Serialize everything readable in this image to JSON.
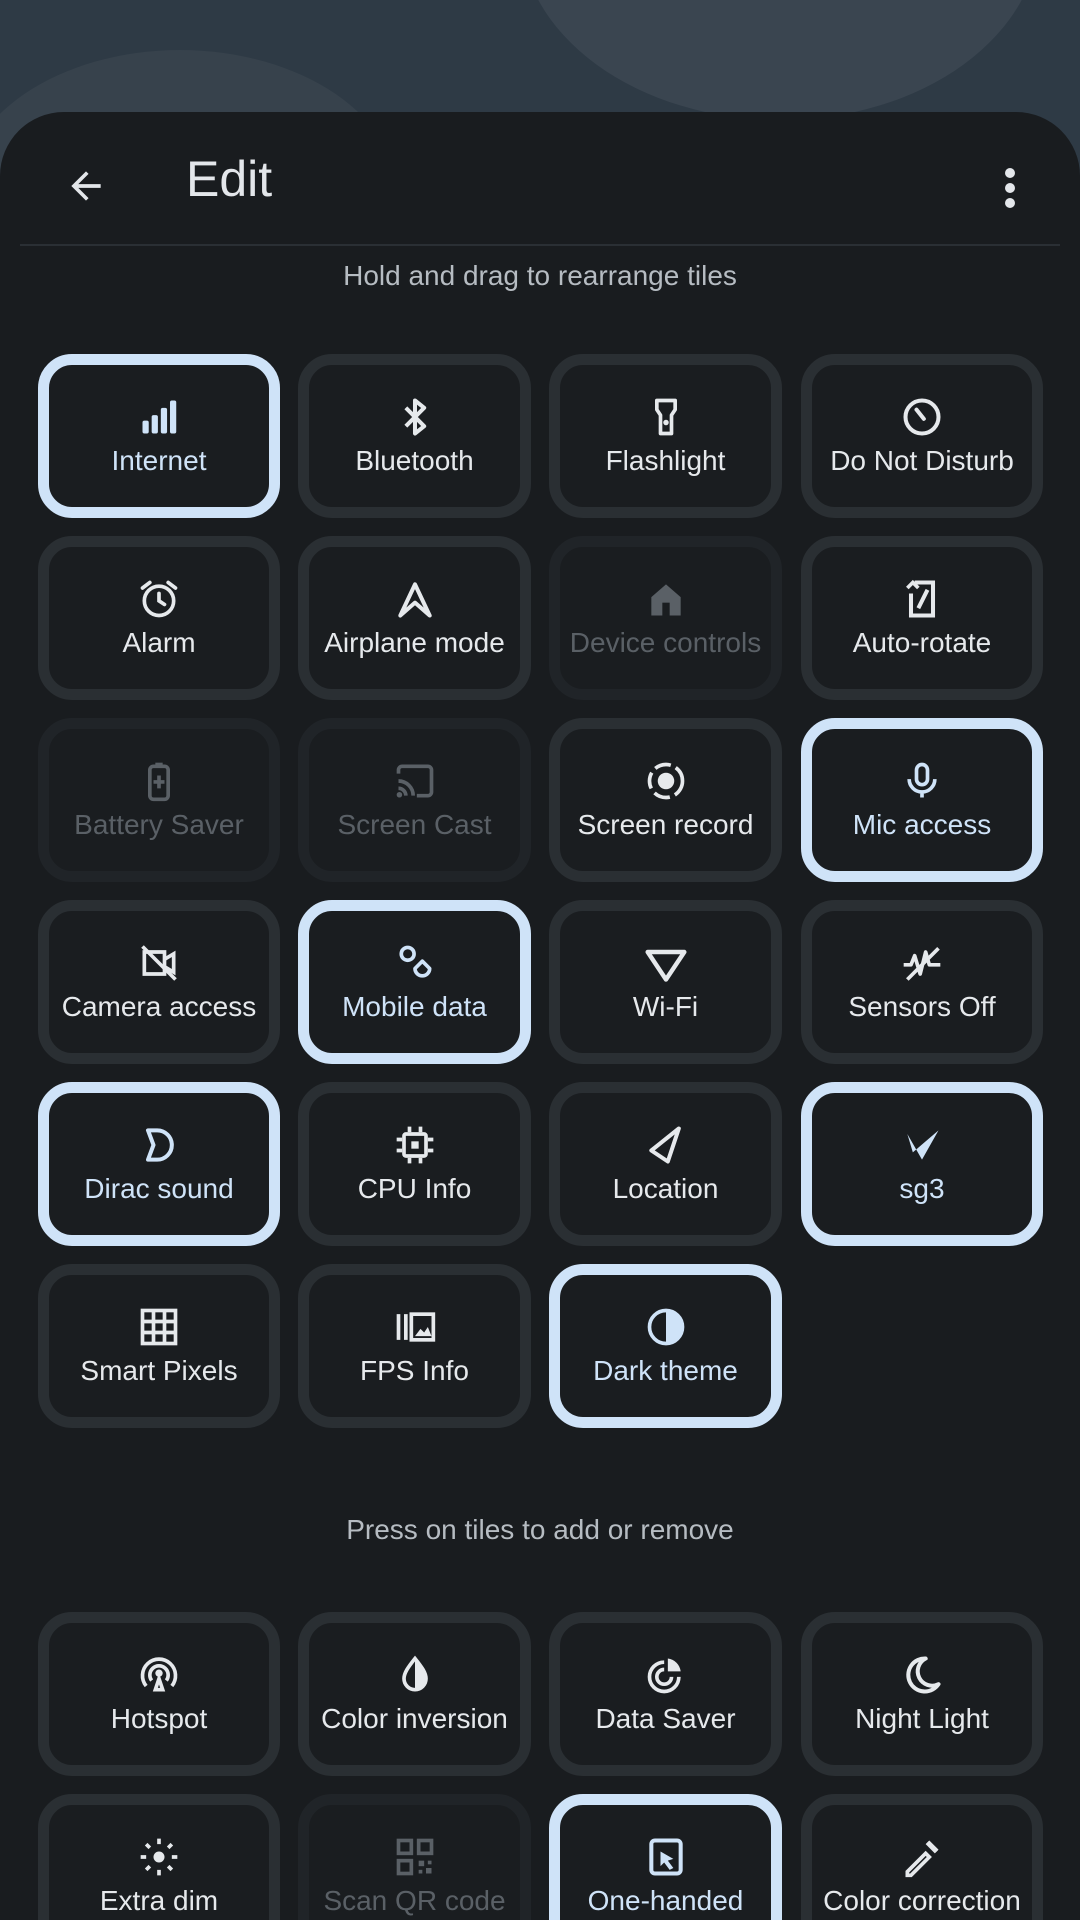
{
  "header": {
    "title": "Edit",
    "back_icon": "arrow-left-icon",
    "more_icon": "more-vert-icon"
  },
  "hints": {
    "rearrange": "Hold and drag to rearrange tiles",
    "add_remove": "Press on tiles to add or remove"
  },
  "colors": {
    "panel_bg": "#191c1f",
    "active_border": "#cfe3f8",
    "tile_border": "#2a2f33",
    "text": "#e6e9ec",
    "disabled_text": "#5a6066"
  },
  "active_tiles": [
    {
      "label": "Internet",
      "icon": "signal-icon",
      "state": "active"
    },
    {
      "label": "Bluetooth",
      "icon": "bluetooth-icon",
      "state": "normal"
    },
    {
      "label": "Flashlight",
      "icon": "flashlight-icon",
      "state": "normal"
    },
    {
      "label": "Do Not Disturb",
      "icon": "do-not-disturb-icon",
      "state": "normal"
    },
    {
      "label": "Alarm",
      "icon": "alarm-icon",
      "state": "normal"
    },
    {
      "label": "Airplane mode",
      "icon": "airplane-icon",
      "state": "normal"
    },
    {
      "label": "Device controls",
      "icon": "home-icon",
      "state": "disabled"
    },
    {
      "label": "Auto-rotate",
      "icon": "auto-rotate-icon",
      "state": "normal"
    },
    {
      "label": "Battery Saver",
      "icon": "battery-icon",
      "state": "disabled"
    },
    {
      "label": "Screen Cast",
      "icon": "cast-icon",
      "state": "disabled"
    },
    {
      "label": "Screen record",
      "icon": "record-icon",
      "state": "normal"
    },
    {
      "label": "Mic access",
      "icon": "mic-icon",
      "state": "active"
    },
    {
      "label": "Camera access",
      "icon": "camera-off-icon",
      "state": "normal"
    },
    {
      "label": "Mobile data",
      "icon": "mobile-data-icon",
      "state": "active"
    },
    {
      "label": "Wi-Fi",
      "icon": "wifi-icon",
      "state": "normal"
    },
    {
      "label": "Sensors Off",
      "icon": "sensors-off-icon",
      "state": "normal"
    },
    {
      "label": "Dirac sound",
      "icon": "dirac-icon",
      "state": "active"
    },
    {
      "label": "CPU Info",
      "icon": "cpu-icon",
      "state": "normal"
    },
    {
      "label": "Location",
      "icon": "location-icon",
      "state": "normal"
    },
    {
      "label": "sg3",
      "icon": "sg3-icon",
      "state": "active"
    },
    {
      "label": "Smart Pixels",
      "icon": "grid-icon",
      "state": "normal"
    },
    {
      "label": "FPS Info",
      "icon": "fps-icon",
      "state": "normal"
    },
    {
      "label": "Dark theme",
      "icon": "dark-theme-icon",
      "state": "active"
    }
  ],
  "available_tiles": [
    {
      "label": "Hotspot",
      "icon": "hotspot-icon",
      "state": "normal"
    },
    {
      "label": "Color inversion",
      "icon": "color-inversion-icon",
      "state": "normal"
    },
    {
      "label": "Data Saver",
      "icon": "data-saver-icon",
      "state": "normal"
    },
    {
      "label": "Night Light",
      "icon": "night-light-icon",
      "state": "normal"
    },
    {
      "label": "Extra dim",
      "icon": "extra-dim-icon",
      "state": "normal"
    },
    {
      "label": "Scan QR code",
      "icon": "qr-code-icon",
      "state": "disabled"
    },
    {
      "label": "One-handed",
      "icon": "one-handed-icon",
      "state": "active"
    },
    {
      "label": "Color correction",
      "icon": "color-correction-icon",
      "state": "normal"
    }
  ]
}
